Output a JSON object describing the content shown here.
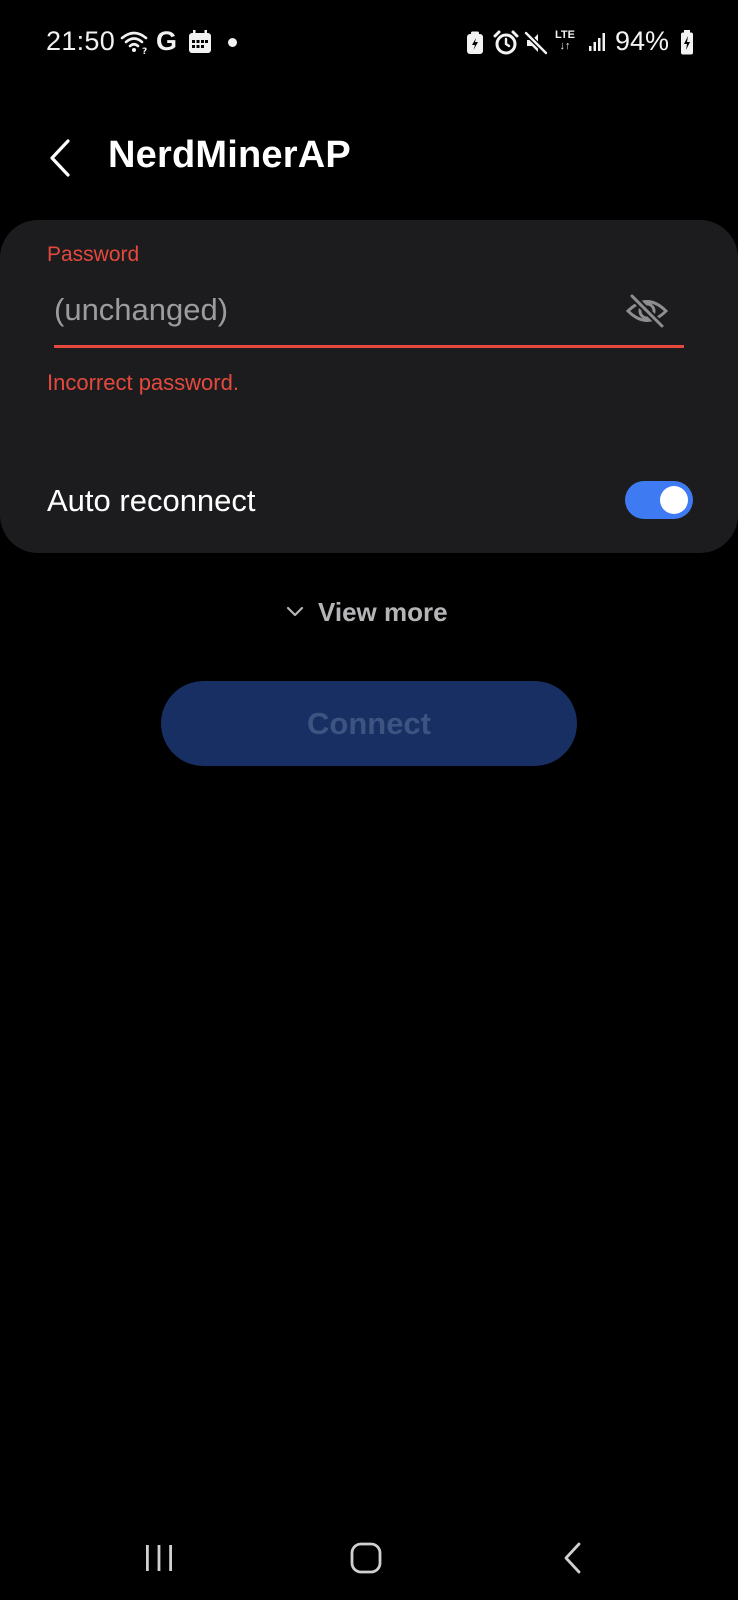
{
  "status_bar": {
    "time": "21:50",
    "google_letter": "G",
    "network_type": "LTE",
    "network_arrows": "↓↑",
    "battery_percent": "94%",
    "icons": [
      "wifi-icon",
      "google-icon",
      "calendar-icon",
      "notification-dot",
      "battery-saver-icon",
      "alarm-icon",
      "mute-icon",
      "lte-icon",
      "signal-icon",
      "battery-icon"
    ]
  },
  "header": {
    "back_icon": "chevron-left-icon",
    "title": "NerdMinerAP"
  },
  "form": {
    "password_label": "Password",
    "password_placeholder": "(unchanged)",
    "password_value": "",
    "visibility_icon": "eye-off-icon",
    "error_message": "Incorrect password.",
    "auto_reconnect_label": "Auto reconnect",
    "auto_reconnect_on": true
  },
  "view_more": {
    "icon": "chevron-down-icon",
    "label": "View more"
  },
  "connect": {
    "label": "Connect",
    "enabled": false
  },
  "nav_bar": {
    "recents_icon": "recents-icon",
    "home_icon": "home-icon",
    "back_icon": "back-icon"
  },
  "colors": {
    "background": "#000000",
    "card": "#1c1c1e",
    "error": "#e5493e",
    "accent": "#3e7bf2",
    "button_disabled_bg": "#172f63",
    "button_disabled_text": "#3d5380"
  }
}
